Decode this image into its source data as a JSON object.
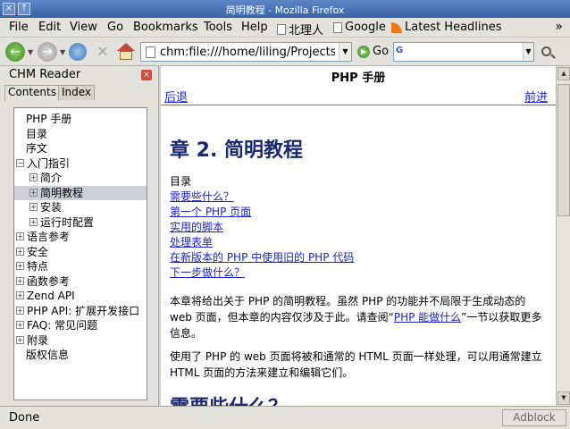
{
  "window": {
    "title": "简明教程 - Mozilla Firefox"
  },
  "menu": {
    "file": "File",
    "edit": "Edit",
    "view": "View",
    "go": "Go",
    "bookmarks": "Bookmarks",
    "tools": "Tools",
    "help": "Help"
  },
  "bookmarks_bar": [
    {
      "label": "北理人",
      "icon": "page-icon"
    },
    {
      "label": "Google",
      "icon": "page-icon"
    },
    {
      "label": "Latest Headlines",
      "icon": "rss-icon"
    }
  ],
  "toolbar": {
    "url": "chm:file:///home/liling/Projects/chm",
    "go_label": "Go"
  },
  "sidebar": {
    "title": "CHM Reader",
    "tabs": [
      "Contents",
      "Index"
    ],
    "tree": [
      {
        "label": "PHP 手册",
        "indent": 0,
        "toggle": ""
      },
      {
        "label": "目录",
        "indent": 0,
        "toggle": ""
      },
      {
        "label": "序文",
        "indent": 0,
        "toggle": ""
      },
      {
        "label": "入门指引",
        "indent": 0,
        "toggle": "−"
      },
      {
        "label": "简介",
        "indent": 1,
        "toggle": "+"
      },
      {
        "label": "简明教程",
        "indent": 1,
        "toggle": "+",
        "selected": true
      },
      {
        "label": "安装",
        "indent": 1,
        "toggle": "+"
      },
      {
        "label": "运行时配置",
        "indent": 1,
        "toggle": "+"
      },
      {
        "label": "语言参考",
        "indent": 0,
        "toggle": "+"
      },
      {
        "label": "安全",
        "indent": 0,
        "toggle": "+"
      },
      {
        "label": "特点",
        "indent": 0,
        "toggle": "+"
      },
      {
        "label": "函数参考",
        "indent": 0,
        "toggle": "+"
      },
      {
        "label": "Zend API",
        "indent": 0,
        "toggle": "+"
      },
      {
        "label": "PHP API: 扩展开发接口",
        "indent": 0,
        "toggle": "+"
      },
      {
        "label": "FAQ: 常见问题",
        "indent": 0,
        "toggle": "+"
      },
      {
        "label": "附录",
        "indent": 0,
        "toggle": "+"
      },
      {
        "label": "版权信息",
        "indent": 0,
        "toggle": ""
      }
    ]
  },
  "content": {
    "header_title": "PHP 手册",
    "prev": "后退",
    "next": "前进",
    "chapter_title": "章 2. 简明教程",
    "toc_label": "目录",
    "toc": [
      "需要些什么？",
      "第一个 PHP 页面",
      "实用的脚本",
      "处理表单",
      "在新版本的 PHP 中使用旧的 PHP 代码",
      "下一步做什么？"
    ],
    "para1_before": "本章将给出关于 PHP 的简明教程。虽然 PHP 的功能并不局限于生成动态的 web 页面，但本章的内容仅涉及于此。请查阅“",
    "para1_link": "PHP 能做什么",
    "para1_after": "”一节以获取更多信息。",
    "para2": "使用了 PHP 的 web 页面将被和通常的 HTML 页面一样处理，可以用通常建立 HTML 页面的方法来建立和编辑它们。",
    "section_title": "需要些什么？"
  },
  "status": {
    "text": "Done",
    "adblock": "Adblock"
  }
}
